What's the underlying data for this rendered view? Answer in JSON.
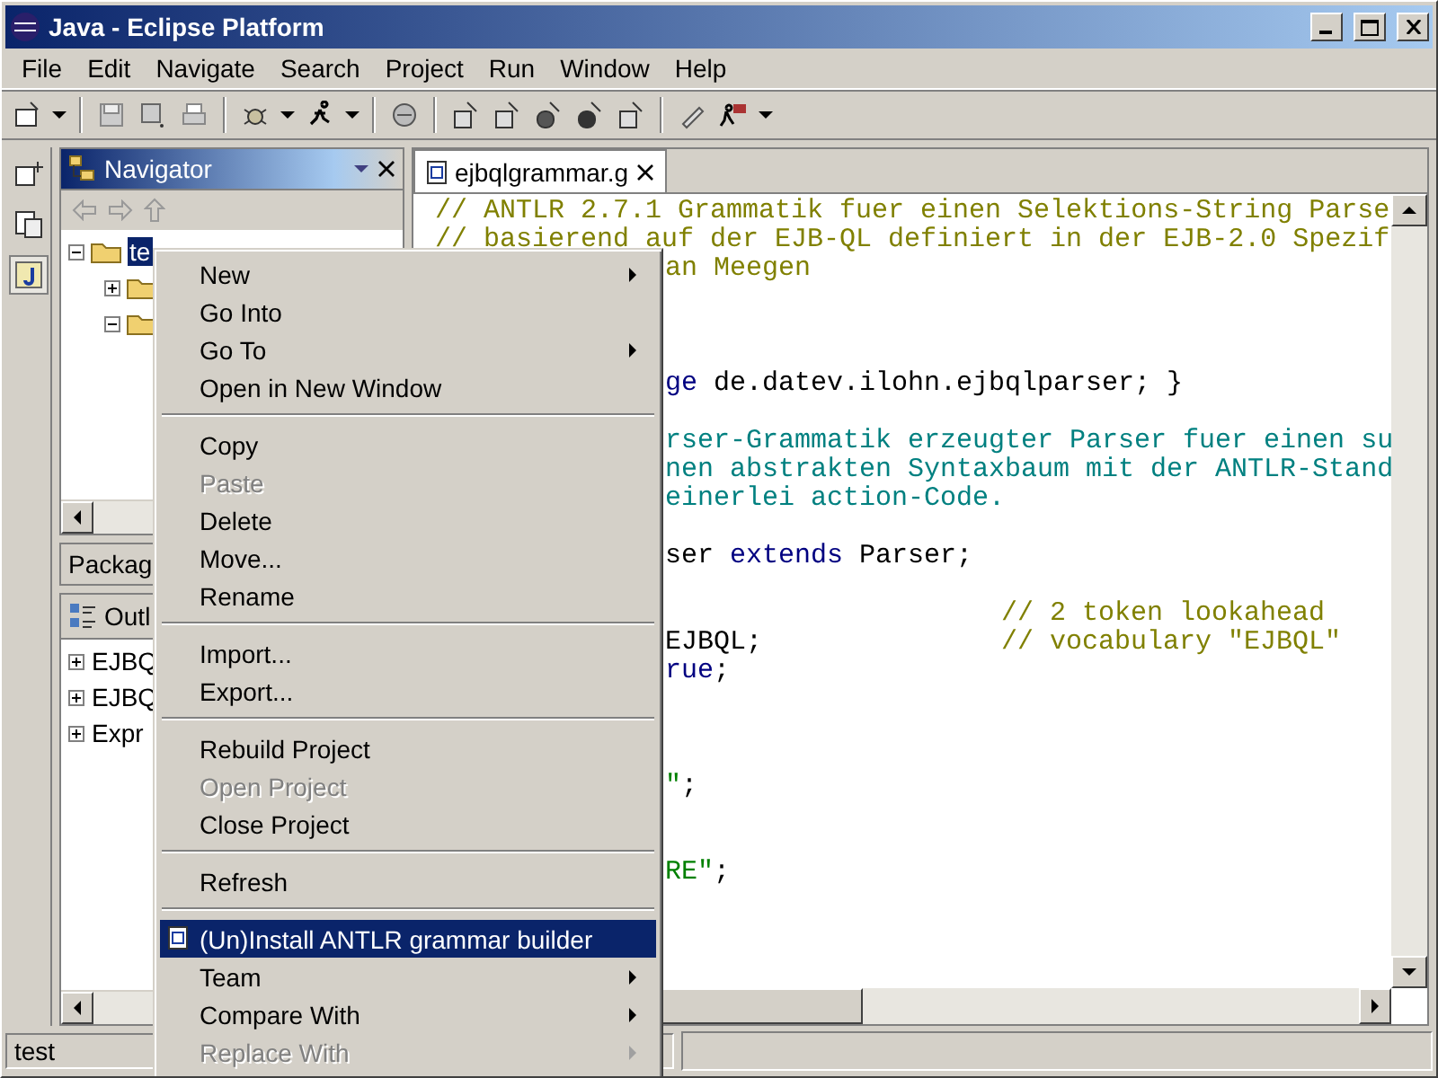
{
  "window": {
    "title": "Java - Eclipse Platform"
  },
  "menu_bar": [
    "File",
    "Edit",
    "Navigate",
    "Search",
    "Project",
    "Run",
    "Window",
    "Help"
  ],
  "navigator": {
    "title": "Navigator",
    "tree": [
      {
        "label": "te",
        "selected": true,
        "expanded": true,
        "children": [
          {
            "expanded": false
          },
          {
            "expanded": true
          }
        ]
      }
    ]
  },
  "package_tab": {
    "label": "Packag"
  },
  "outline": {
    "title": "Outl",
    "items": [
      {
        "label": "EJBQ",
        "expanded": false
      },
      {
        "label": "EJBQ",
        "expanded": false
      },
      {
        "label": "Expr",
        "expanded": false
      }
    ]
  },
  "editor": {
    "tab": "ejbqlgrammar.g",
    "lines": [
      {
        "kind": "code",
        "hidden_start": false,
        "segments": [
          {
            "kind": "comment",
            "text": "// ANTLR 2.7.1 Grammatik fuer einen Selektions-String Parse"
          }
        ]
      },
      {
        "kind": "code",
        "hidden_start": false,
        "segments": [
          {
            "kind": "comment",
            "text": "// basierend auf der EJB-QL definiert in der EJB-2.0 Spezif"
          }
        ]
      },
      {
        "kind": "code",
        "hidden_start": true,
        "segments": [
          {
            "kind": "comment",
            "text": "an Meegen"
          }
        ]
      },
      {
        "kind": "blank"
      },
      {
        "kind": "blank"
      },
      {
        "kind": "blank"
      },
      {
        "kind": "code",
        "hidden_start": true,
        "segments": [
          {
            "kind": "keyword",
            "text": "ge"
          },
          {
            "kind": "plain",
            "text": " de.datev.ilohn.ejbqlparser; }"
          }
        ]
      },
      {
        "kind": "blank"
      },
      {
        "kind": "code",
        "hidden_start": true,
        "segments": [
          {
            "kind": "doc",
            "text": "rser-Grammatik erzeugter Parser fuer einen su"
          }
        ]
      },
      {
        "kind": "code",
        "hidden_start": true,
        "segments": [
          {
            "kind": "doc",
            "text": "nen abstrakten Syntaxbaum mit der ANTLR-Stand"
          }
        ]
      },
      {
        "kind": "code",
        "hidden_start": true,
        "segments": [
          {
            "kind": "doc",
            "text": "einerlei action-Code."
          }
        ]
      },
      {
        "kind": "blank"
      },
      {
        "kind": "code",
        "hidden_start": true,
        "segments": [
          {
            "kind": "plain",
            "text": "ser"
          },
          {
            "kind": "keyword",
            "text": " extends"
          },
          {
            "kind": "plain",
            "text": " Parser;"
          }
        ]
      },
      {
        "kind": "blank"
      },
      {
        "kind": "code",
        "hidden_start": true,
        "eol_comment": "// 2 token lookahead"
      },
      {
        "kind": "code",
        "hidden_start": true,
        "segments": [
          {
            "kind": "plain",
            "text": "EJBQL;"
          }
        ],
        "eol_comment": "// vocabulary \"EJBQL\""
      },
      {
        "kind": "code",
        "hidden_start": true,
        "segments": [
          {
            "kind": "keyword",
            "text": "rue"
          },
          {
            "kind": "plain",
            "text": ";"
          }
        ]
      },
      {
        "kind": "blank"
      },
      {
        "kind": "blank"
      },
      {
        "kind": "blank"
      },
      {
        "kind": "code",
        "hidden_start": true,
        "segments": [
          {
            "kind": "string",
            "text": "\""
          },
          {
            "kind": "plain",
            "text": ";"
          }
        ]
      },
      {
        "kind": "blank"
      },
      {
        "kind": "blank"
      },
      {
        "kind": "code",
        "hidden_start": true,
        "segments": [
          {
            "kind": "string",
            "text": "RE\""
          },
          {
            "kind": "plain",
            "text": ";"
          }
        ]
      }
    ]
  },
  "context_menu": [
    {
      "kind": "item",
      "label": "New",
      "submenu": true,
      "disabled": false,
      "selected": false
    },
    {
      "kind": "item",
      "label": "Go Into",
      "submenu": false,
      "disabled": false,
      "selected": false
    },
    {
      "kind": "item",
      "label": "Go To",
      "submenu": true,
      "disabled": false,
      "selected": false
    },
    {
      "kind": "item",
      "label": "Open in New Window",
      "submenu": false,
      "disabled": false,
      "selected": false
    },
    {
      "kind": "separator"
    },
    {
      "kind": "item",
      "label": "Copy",
      "submenu": false,
      "disabled": false,
      "selected": false
    },
    {
      "kind": "item",
      "label": "Paste",
      "submenu": false,
      "disabled": true,
      "selected": false
    },
    {
      "kind": "item",
      "label": "Delete",
      "submenu": false,
      "disabled": false,
      "selected": false
    },
    {
      "kind": "item",
      "label": "Move...",
      "submenu": false,
      "disabled": false,
      "selected": false
    },
    {
      "kind": "item",
      "label": "Rename",
      "submenu": false,
      "disabled": false,
      "selected": false
    },
    {
      "kind": "separator"
    },
    {
      "kind": "item",
      "label": "Import...",
      "submenu": false,
      "disabled": false,
      "selected": false
    },
    {
      "kind": "item",
      "label": "Export...",
      "submenu": false,
      "disabled": false,
      "selected": false
    },
    {
      "kind": "separator"
    },
    {
      "kind": "item",
      "label": "Rebuild Project",
      "submenu": false,
      "disabled": false,
      "selected": false
    },
    {
      "kind": "item",
      "label": "Open Project",
      "submenu": false,
      "disabled": true,
      "selected": false
    },
    {
      "kind": "item",
      "label": "Close Project",
      "submenu": false,
      "disabled": false,
      "selected": false
    },
    {
      "kind": "separator"
    },
    {
      "kind": "item",
      "label": "Refresh",
      "submenu": false,
      "disabled": false,
      "selected": false
    },
    {
      "kind": "separator"
    },
    {
      "kind": "item",
      "label": "(Un)Install ANTLR grammar builder",
      "submenu": false,
      "disabled": false,
      "selected": true,
      "icon": true
    },
    {
      "kind": "item",
      "label": "Team",
      "submenu": true,
      "disabled": false,
      "selected": false
    },
    {
      "kind": "item",
      "label": "Compare With",
      "submenu": true,
      "disabled": false,
      "selected": false
    },
    {
      "kind": "item",
      "label": "Replace With",
      "submenu": true,
      "disabled": true,
      "selected": false
    }
  ],
  "status_bar": "test"
}
